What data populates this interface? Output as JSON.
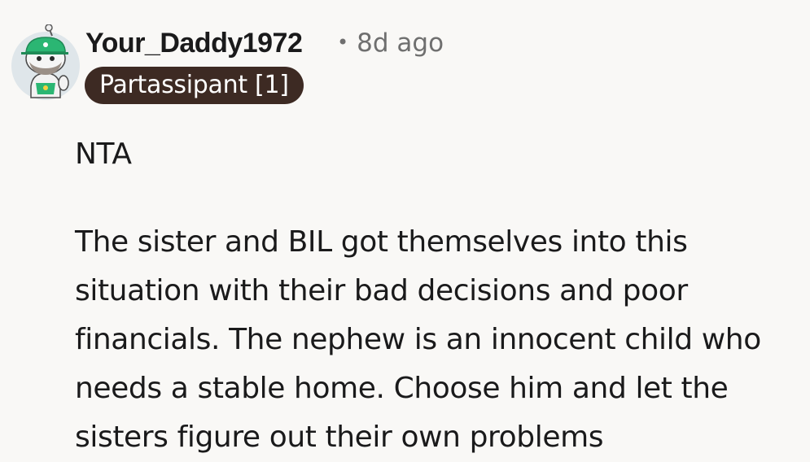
{
  "comment": {
    "author": "Your_Daddy1972",
    "separator": "•",
    "timestamp": "8d ago",
    "flair": "Partassipant [1]",
    "paragraphs": [
      "NTA",
      "The sister and BIL got themselves into this situation with their bad decisions and poor financials. The nephew is an innocent child who needs a stable home. Choose him and let the sisters figure out their own problems"
    ]
  },
  "colors": {
    "background": "#f9f8f6",
    "flair_bg": "#3d2a23",
    "flair_text": "#ffffff",
    "meta_text": "#6f6f6f",
    "avatar_cap": "#2bb673"
  },
  "icons": {
    "avatar": "snoo-avatar-green-cap"
  }
}
